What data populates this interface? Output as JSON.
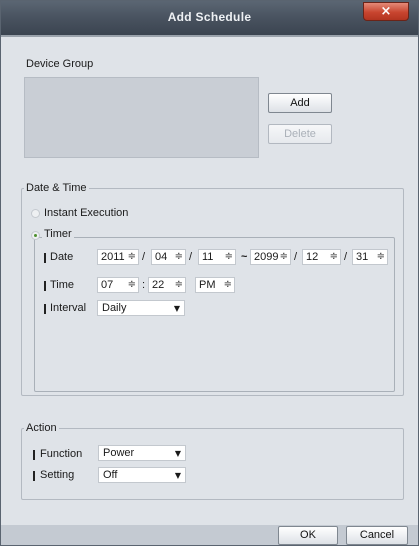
{
  "window": {
    "title": "Add Schedule",
    "close_glyph": "×"
  },
  "device_group": {
    "label": "Device Group",
    "add_label": "Add",
    "delete_label": "Delete"
  },
  "date_time": {
    "label": "Date & Time",
    "instant_label": "Instant Execution",
    "timer_label": "Timer",
    "date_label": "Date",
    "start_year": "2011",
    "start_month": "04",
    "start_day": "11",
    "range_sep": "~",
    "end_year": "2099",
    "end_month": "12",
    "end_day": "31",
    "date_sep": "/",
    "time_label": "Time",
    "hour": "07",
    "minute": "22",
    "ampm": "PM",
    "time_sep": ":",
    "interval_label": "Interval",
    "interval_value": "Daily"
  },
  "action": {
    "label": "Action",
    "function_label": "Function",
    "function_value": "Power",
    "setting_label": "Setting",
    "setting_value": "Off"
  },
  "footer": {
    "ok_label": "OK",
    "cancel_label": "Cancel"
  },
  "icons": {
    "spin": "≑",
    "dropdown": "▼"
  },
  "colors": {
    "titlebar": "#4a5461",
    "close": "#c8452f",
    "dialog_bg": "#dfe3e8",
    "radio_on": "#4d8f2f"
  }
}
